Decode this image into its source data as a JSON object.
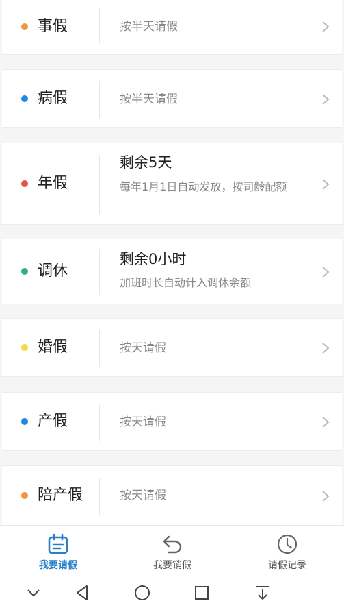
{
  "leave_types": [
    {
      "name": "事假",
      "dot_color": "#f0953a",
      "desc": "按半天请假"
    },
    {
      "name": "病假",
      "dot_color": "#1e88e5",
      "desc": "按半天请假"
    },
    {
      "name": "年假",
      "dot_color": "#e05545",
      "balance": "剩余5天",
      "note": "每年1月1日自动发放，按司龄配额"
    },
    {
      "name": "调休",
      "dot_color": "#29b27a",
      "balance": "剩余0小时",
      "note": "加班时长自动计入调休余额"
    },
    {
      "name": "婚假",
      "dot_color": "#f5d94a",
      "desc": "按天请假"
    },
    {
      "name": "产假",
      "dot_color": "#1e88e5",
      "desc": "按天请假"
    },
    {
      "name": "陪产假",
      "dot_color": "#f0953a",
      "desc": "按天请假"
    }
  ],
  "tabs": [
    {
      "label": "我要请假",
      "icon": "calendar-icon",
      "active": true
    },
    {
      "label": "我要销假",
      "icon": "undo-arrow-icon",
      "active": false
    },
    {
      "label": "请假记录",
      "icon": "clock-icon",
      "active": false
    }
  ],
  "colors": {
    "active_tab": "#2a7fc9",
    "inactive_tab": "#555555"
  },
  "system_nav": [
    "collapse-icon",
    "back-icon",
    "home-icon",
    "recents-icon",
    "pull-down-icon"
  ]
}
